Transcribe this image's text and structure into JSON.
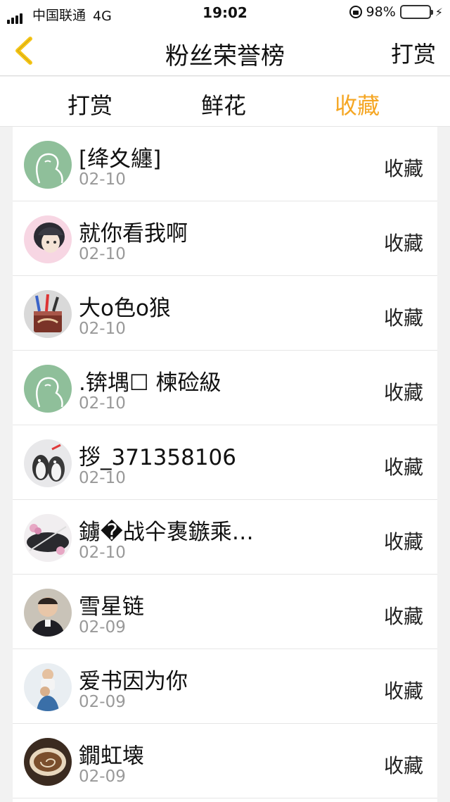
{
  "status_bar": {
    "carrier": "中国联通",
    "network": "4G",
    "time": "19:02",
    "battery": "98%",
    "battery_level": 0.98,
    "battery_color": "#34c759"
  },
  "nav": {
    "back_icon": "chevron-left-icon",
    "title": "粉丝荣誉榜",
    "right_button": "打赏",
    "back_color": "#f5c518"
  },
  "tabs": [
    {
      "label": "打赏",
      "active": false
    },
    {
      "label": "鲜花",
      "active": false
    },
    {
      "label": "收藏",
      "active": true
    }
  ],
  "accent_color": "#f5a623",
  "fans": [
    {
      "name": "[绛夊纏]",
      "date": "02-10",
      "action": "收藏",
      "avatar": "default-silhouette"
    },
    {
      "name": "就你看我啊",
      "date": "02-10",
      "action": "收藏",
      "avatar": "anime-girl"
    },
    {
      "name": "大o色o狼",
      "date": "02-10",
      "action": "收藏",
      "avatar": "pencil-cup"
    },
    {
      "name": ".锛堣☐ 楝硷級",
      "date": "02-10",
      "action": "收藏",
      "avatar": "default-silhouette"
    },
    {
      "name": "拶_371358106",
      "date": "02-10",
      "action": "收藏",
      "avatar": "penguins"
    },
    {
      "name": "鐪�战仐褢鏃乘…",
      "date": "02-10",
      "action": "收藏",
      "avatar": "flowers-sword"
    },
    {
      "name": "雪星链",
      "date": "02-09",
      "action": "收藏",
      "avatar": "boy-photo"
    },
    {
      "name": "爱书因为你",
      "date": "02-09",
      "action": "收藏",
      "avatar": "parent-child"
    },
    {
      "name": "鐗虹壊",
      "date": "02-09",
      "action": "收藏",
      "avatar": "coffee-cup"
    }
  ]
}
